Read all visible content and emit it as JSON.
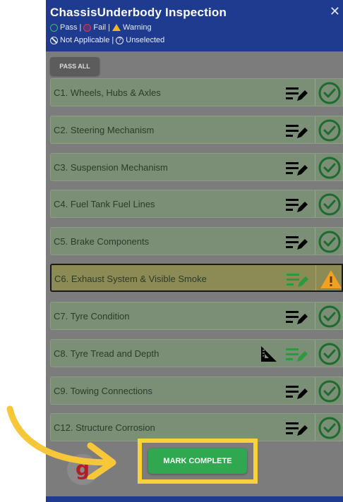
{
  "header": {
    "title": "ChassisUnderbody Inspection",
    "close_glyph": "✕",
    "legend": {
      "pass": "Pass |",
      "fail": "Fail |",
      "warning": "Warning",
      "not_applicable": "Not Applicable |",
      "unselected": "Unselected"
    }
  },
  "pass_all_label": "PASS ALL",
  "items": [
    {
      "label": "C1. Wheels, Hubs & Axles",
      "status": "pass",
      "note_active": false,
      "has_measure": false
    },
    {
      "label": "C2. Steering Mechanism",
      "status": "pass",
      "note_active": false,
      "has_measure": false
    },
    {
      "label": "C3. Suspension Mechanism",
      "status": "pass",
      "note_active": false,
      "has_measure": false
    },
    {
      "label": "C4. Fuel Tank Fuel Lines",
      "status": "pass",
      "note_active": false,
      "has_measure": false
    },
    {
      "label": "C5. Brake Components",
      "status": "pass",
      "note_active": false,
      "has_measure": false
    },
    {
      "label": "C6. Exhaust System & Visible Smoke",
      "status": "warning",
      "note_active": true,
      "has_measure": false
    },
    {
      "label": "C7. Tyre Condition",
      "status": "pass",
      "note_active": false,
      "has_measure": false
    },
    {
      "label": "C8. Tyre Tread and Depth",
      "status": "pass",
      "note_active": true,
      "has_measure": true
    },
    {
      "label": "C9. Towing Connections",
      "status": "pass",
      "note_active": false,
      "has_measure": false
    },
    {
      "label": "C12. Structure Corrosion",
      "status": "pass",
      "note_active": false,
      "has_measure": false
    }
  ],
  "mark_complete_label": "MARK COMPLETE",
  "logo_text": "g",
  "colors": {
    "header_bg": "#1f3b8f",
    "pass": "#1e6b2e",
    "note_active": "#2b9a3e",
    "warning": "#f1a020",
    "highlight": "#f7d23a"
  }
}
